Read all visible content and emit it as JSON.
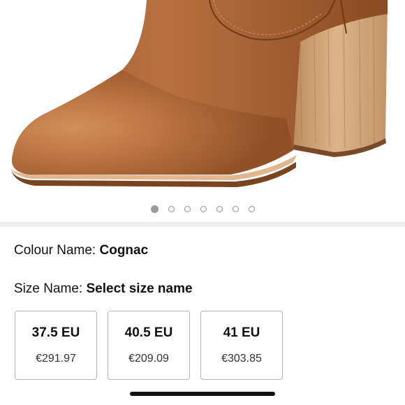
{
  "product": {
    "image_alt": "Cognac leather ankle boot with stacked wooden heel",
    "carousel": {
      "total": 7,
      "active_index": 0
    }
  },
  "colour": {
    "label": "Colour Name:",
    "value": "Cognac"
  },
  "size": {
    "label": "Size Name:",
    "value": "Select size name",
    "options": [
      {
        "size": "37.5 EU",
        "price": "€291.97"
      },
      {
        "size": "40.5 EU",
        "price": "€209.09"
      },
      {
        "size": "41 EU",
        "price": "€303.85"
      }
    ]
  },
  "colors": {
    "leather": "#b8703f",
    "heel": "#cfa071",
    "dot_active": "#9a9a9a",
    "divider": "#eeeeee"
  }
}
